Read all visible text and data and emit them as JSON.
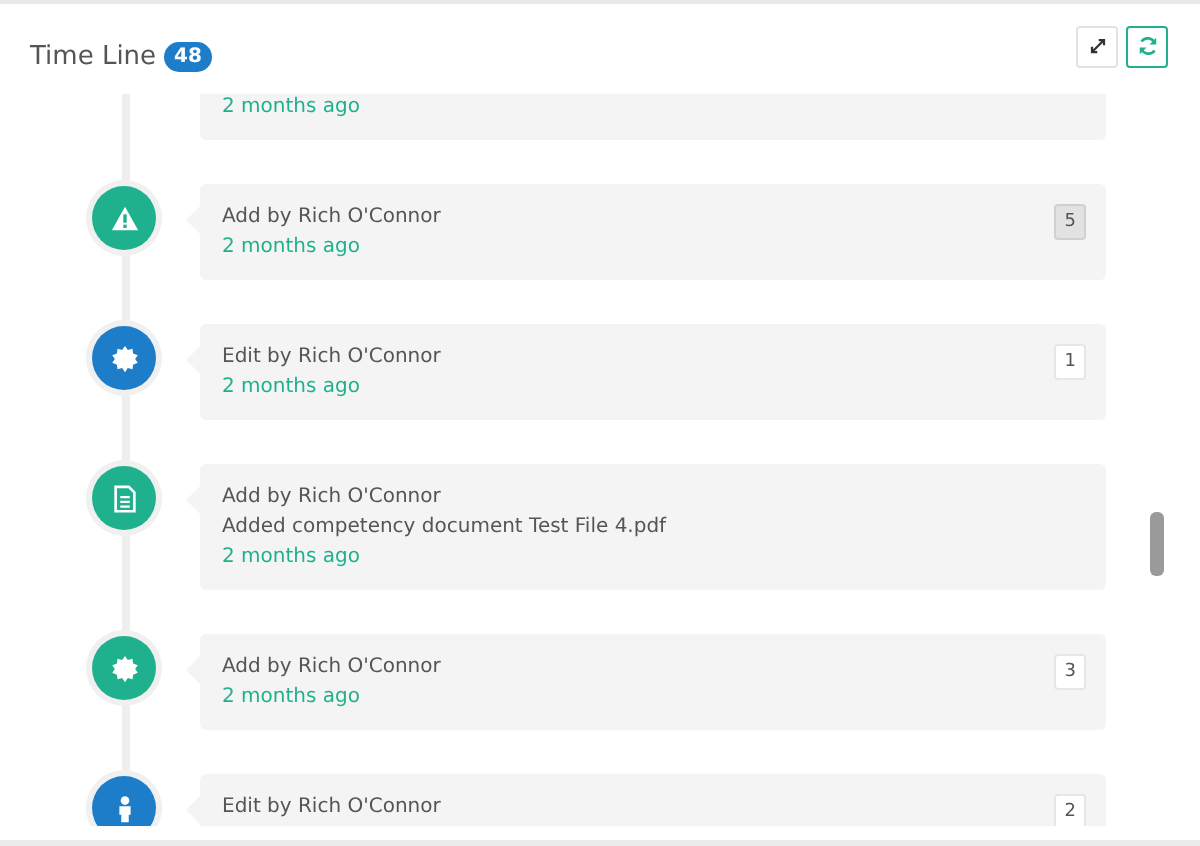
{
  "header": {
    "title": "Time Line",
    "count": "48"
  },
  "toolbar": [
    {
      "kind": "expand",
      "active": false
    },
    {
      "kind": "refresh",
      "active": true
    }
  ],
  "timeline": [
    {
      "time": "2 months ago"
    },
    {
      "kind": "warning",
      "color": "#1fb18e",
      "title": "Add by Rich O'Connor",
      "time": "2 months ago",
      "badge": "5",
      "badge_shaded": true
    },
    {
      "kind": "seal",
      "color": "#1e7dc8",
      "title": "Edit by Rich O'Connor",
      "time": "2 months ago",
      "badge": "1",
      "badge_shaded": false
    },
    {
      "kind": "document",
      "color": "#1fb18e",
      "title": "Add by Rich O'Connor",
      "detail": "Added competency document Test File 4.pdf",
      "time": "2 months ago"
    },
    {
      "kind": "seal",
      "color": "#1fb18e",
      "title": "Add by Rich O'Connor",
      "time": "2 months ago",
      "badge": "3",
      "badge_shaded": false
    },
    {
      "kind": "person",
      "color": "#1e7dc8",
      "title": "Edit by Rich O'Connor",
      "badge": "2",
      "badge_shaded": false
    }
  ]
}
